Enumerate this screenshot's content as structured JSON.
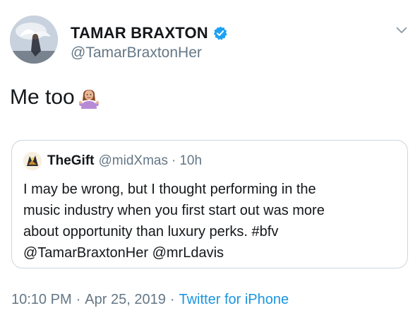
{
  "tweet": {
    "author": {
      "name": "TAMAR BRAXTON",
      "handle": "@TamarBraxtonHer",
      "verified": true,
      "avatar_icon": "avatar-angel-image"
    },
    "text": "Me too",
    "emoji": "person-shrugging-emoji",
    "menu_icon": "chevron-down-icon",
    "quoted": {
      "author_name": "TheGift",
      "handle": "@midXmas",
      "separator": "·",
      "time": "10h",
      "avatar_icon": "avatar-quoted-image",
      "text_lines": [
        "I may be wrong, but I thought performing in the",
        "music industry when you first start out was more",
        "about opportunity than luxury perks. #bfv",
        "@TamarBraxtonHer @mrLdavis"
      ]
    },
    "meta": {
      "time": "10:10 PM",
      "separator_1": "·",
      "date": "Apr 25, 2019",
      "separator_2": "·",
      "source": "Twitter for iPhone"
    }
  },
  "colors": {
    "primary_text": "#14171a",
    "secondary_text": "#657786",
    "link_blue": "#1b95e0",
    "verified_blue": "#1da1f2",
    "card_border": "#ccd6dd"
  }
}
